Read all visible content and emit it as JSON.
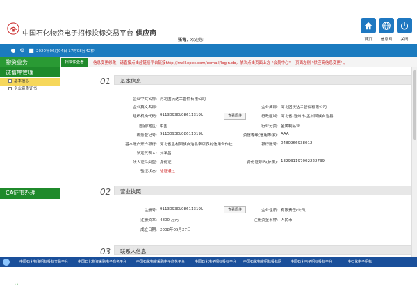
{
  "header": {
    "title_a": "中国石化物资电子招标投标交易平台",
    "title_b": "供应商",
    "greeting_name": "张青",
    "greeting_suffix": "，欢迎您!",
    "buttons": [
      {
        "label": "首页",
        "icon": "home-icon"
      },
      {
        "label": "信息网",
        "icon": "globe-icon"
      },
      {
        "label": "关闭",
        "icon": "power-icon"
      }
    ]
  },
  "topbar": {
    "datetime": "2020年06月04日 17时08分42秒",
    "icons": [
      "chat-icon",
      "gear-icon",
      "user-icon"
    ]
  },
  "sidebar": {
    "sections": [
      {
        "label": "物资业务"
      },
      {
        "label": "诚信库管理"
      }
    ],
    "subitems": [
      {
        "label": "基本信息",
        "selected": true
      },
      {
        "label": "企业资质证书",
        "selected": false
      }
    ],
    "ca": "CA证书办理"
  },
  "tabs": {
    "active": "扫描件查看",
    "notice": "信息变更修改，请直接点击超链接平台链接http://mall.epec.com/ecmall/login.do。依次点击页面上方 \"会员中心\" —页面左侧 \"供应商信息变更\" 。"
  },
  "section1": {
    "num": "01",
    "title": "基本信息",
    "left": [
      {
        "label": "企业中文名称:",
        "value": "河北固沅达兰管件有限公司"
      },
      {
        "label": "企业英文名称:",
        "value": ""
      },
      {
        "label": "组织机构代码:",
        "value": "91130930L08611319L"
      },
      {
        "label": "国别/地区:",
        "value": "中国"
      },
      {
        "label": "税务登记号:",
        "value": "91130930L08611319L"
      },
      {
        "label": "基本账户开户银行:",
        "value": "河北省孟村回族自治县辛店农村信用合作社"
      },
      {
        "label": "法定代表人:",
        "value": "刘学昌"
      },
      {
        "label": "法人证件类型:",
        "value": "身份证"
      },
      {
        "label": "验证状态:",
        "value": "验证通过"
      }
    ],
    "right": [
      {
        "label": "企业简称:",
        "value": "河北固沅达兰管件有限公司"
      },
      {
        "label": "行政区域:",
        "value": "河北省-沧州市-孟村回族自治县"
      },
      {
        "label": "行业分类:",
        "value": "金属制品业"
      },
      {
        "label": "资信等级(信用等级):",
        "value": "AAA"
      },
      {
        "label": "银行账号:",
        "value": "0480966938012"
      },
      {
        "label": "身份证号码(护照):",
        "value": "132931197002222739"
      }
    ],
    "view_btn": "查看原件"
  },
  "section2": {
    "num": "02",
    "title": "营业执照",
    "left": [
      {
        "label": "注册号:",
        "value": "91130930L08611319L"
      },
      {
        "label": "注册资本:",
        "value": "4800 万元"
      },
      {
        "label": "成立日期:",
        "value": "2008年05月27日"
      }
    ],
    "right": [
      {
        "label": "企业性质:",
        "value": "有限责任(公司)"
      },
      {
        "label": "注册资金币种:",
        "value": "人民币"
      }
    ],
    "view_btn": "查看原件"
  },
  "section3": {
    "num": "03",
    "title": "联系人信息"
  },
  "taskbar": [
    "中国石化物资招标投标交易平台",
    "中国石化物资采购电子商务平台",
    "中国石化物资采购电子商务平台",
    "中国石化电子招标投标平台",
    "中国石化物资招标投标网",
    "中国石化电子招标投标平台",
    "中石化电子招标"
  ],
  "colors": {
    "brand_blue": "#1b7bbf",
    "brand_green": "#1f8a2b",
    "alert_red": "#cc2222"
  }
}
